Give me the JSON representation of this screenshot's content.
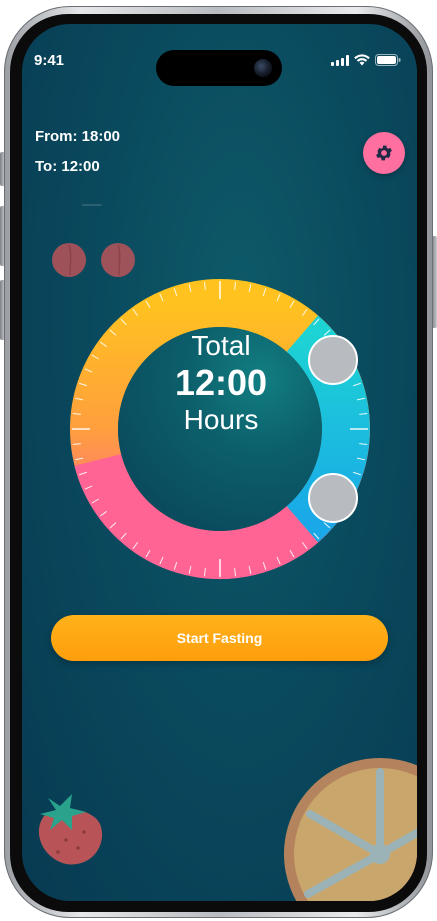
{
  "status_bar": {
    "time": "9:41"
  },
  "fasting_window": {
    "from": "From: 18:00",
    "to": "To: 12:00"
  },
  "dial": {
    "label": "Total",
    "value": "12:00",
    "unit": "Hours"
  },
  "actions": {
    "start_label": "Start Fasting"
  },
  "icons": {
    "settings": "gear-icon",
    "decor": [
      "cherry-icon",
      "strawberry-icon",
      "orange-slice-icon"
    ]
  },
  "colors": {
    "background": "#0a4a5e",
    "accent_pink": "#ff6fa0",
    "button_orange": "#ffa411",
    "ring_yellow": "#ffc21f",
    "ring_cyan": "#1dd3d3",
    "ring_pink": "#ff5e9a"
  }
}
